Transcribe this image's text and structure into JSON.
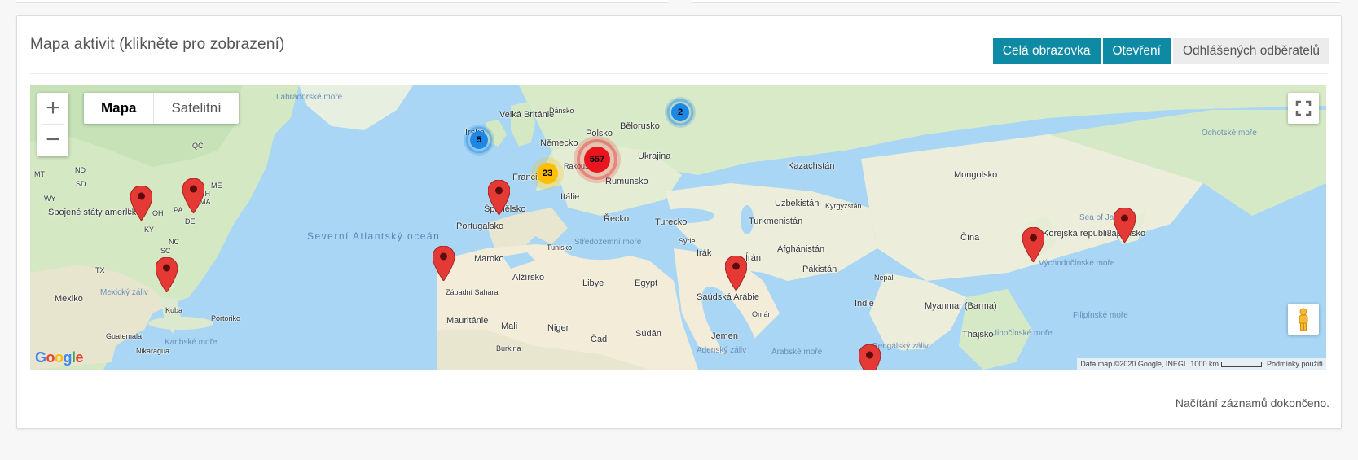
{
  "panel": {
    "title": "Mapa aktivit (klikněte pro zobrazení)",
    "buttons": {
      "fullscreen": "Celá obrazovka",
      "opens": "Otevření",
      "unsubscribed": "Odhlášených odběratelů"
    },
    "status": "Načítání záznamů dokončeno."
  },
  "map": {
    "controls": {
      "zoom_in": "+",
      "zoom_out": "−",
      "type_map": "Mapa",
      "type_satellite": "Satelitní",
      "fullscreen_icon": "fullscreen-icon",
      "pegman_icon": "street-view-pegman-icon"
    },
    "clusters": [
      {
        "count": "557",
        "color": "#e8141e"
      },
      {
        "count": "23",
        "color": "#ffbf00"
      },
      {
        "count": "5",
        "color": "#1d87e5"
      },
      {
        "count": "2",
        "color": "#1d87e5"
      }
    ],
    "labels": {
      "usa": "Spojené státy americké",
      "mexico": "Mexiko",
      "gulf": "Mexický záliv",
      "cuba": "Kuba",
      "pr": "Portoriko",
      "guatemala": "Guatemala",
      "nicaragua": "Nikaragua",
      "caribbean": "Karibské moře",
      "labrador": "Labradorské moře",
      "atlantic": "Severní Atlantský oceán",
      "qc": "QC",
      "mt": "MT",
      "nd": "ND",
      "sd": "SD",
      "wy": "WY",
      "il": "IL",
      "oh": "OH",
      "ky": "KY",
      "pa": "PA",
      "nc": "NC",
      "sc": "SC",
      "ma": "MA",
      "me": "ME",
      "nh": "NH",
      "de": "DE",
      "tx": "TX",
      "fl": "FL",
      "ireland": "Irsko",
      "uk": "Velká Británie",
      "denmark": "Dánsko",
      "germany": "Německo",
      "poland": "Polsko",
      "belarus": "Bělorusko",
      "ukraine": "Ukrajina",
      "france": "Francie",
      "austria": "Rakousko",
      "romania": "Rumunsko",
      "italy": "Itálie",
      "spain": "Španělsko",
      "portugal": "Portugalsko",
      "greece": "Řecko",
      "turkey": "Turecko",
      "tunisia": "Tunisko",
      "mediterranean": "Středozemní moře",
      "morocco": "Maroko",
      "algeria": "Alžírsko",
      "libya": "Libye",
      "egypt": "Egypt",
      "w_sahara": "Západní Sahara",
      "mauritania": "Mauritánie",
      "mali": "Mali",
      "niger": "Niger",
      "chad": "Čad",
      "sudan": "Súdán",
      "burkina": "Burkina",
      "syria": "Sýrie",
      "iraq": "Irák",
      "iran": "Írán",
      "saudi": "Saúdská Arábie",
      "oman": "Omán",
      "yemen": "Jemen",
      "arabian_sea": "Arabské moře",
      "aden": "Adenský záliv",
      "kazakhstan": "Kazachstán",
      "uzbekistan": "Uzbekistán",
      "kyrgyzstan": "Kyrgyzstán",
      "turkmenistan": "Turkmenistán",
      "afghanistan": "Afghánistán",
      "pakistan": "Pákistán",
      "nepal": "Nepál",
      "india": "Indie",
      "bengal": "Bengálský záliv",
      "mongolia": "Mongolsko",
      "china": "Čína",
      "korea": "Korejská republika",
      "japan": "Japonsko",
      "sea_of_japan": "Sea of Japan",
      "okhotsk": "Ochotské moře",
      "east_china_sea": "Východočínské moře",
      "myanmar": "Myanmar (Barma)",
      "thailand": "Thajsko",
      "philippine_sea": "Filipínské moře",
      "south_china_sea": "Jihočínské moře"
    },
    "attribution": {
      "data": "Data map ©2020 Google, INEGI",
      "scale": "1000 km",
      "terms": "Podmínky použití"
    },
    "google_logo": [
      "G",
      "o",
      "o",
      "g",
      "l",
      "e"
    ],
    "google_logo_colors": [
      "#4285f4",
      "#ea4335",
      "#fbbc05",
      "#4285f4",
      "#34a853",
      "#ea4335"
    ],
    "colors": {
      "water": "#a8d6f4",
      "land": "#e9ecd9",
      "land_green": "#c8e4b8",
      "desert": "#f3ecd9",
      "marker": "#e53935",
      "accent": "#0e8aa5"
    }
  }
}
